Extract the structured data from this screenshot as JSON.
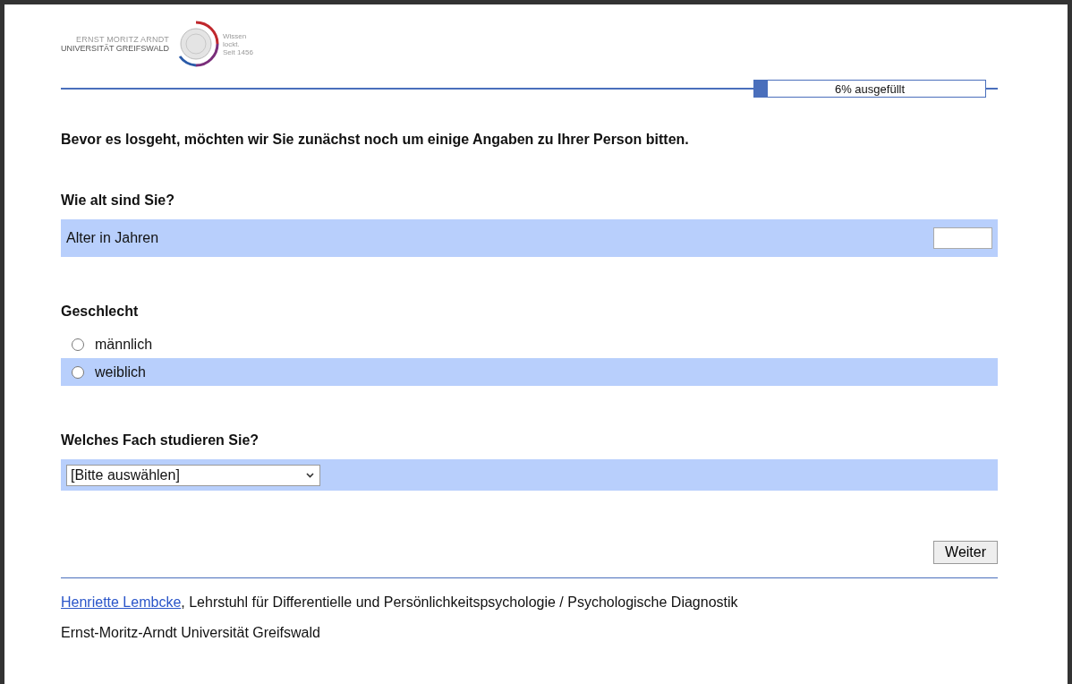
{
  "logo": {
    "line_1": "ERNST MORITZ ARNDT",
    "line_2": "UNIVERSITÄT GREIFSWALD",
    "motto": [
      "Wissen",
      "lockt.",
      "Seit 1456"
    ]
  },
  "progress": {
    "level": 0.06,
    "label": "6% ausgefüllt"
  },
  "intro": "Bevor es losgeht, möchten wir Sie zunächst noch um einige Angaben zu Ihrer Person bitten.",
  "questions": [
    {
      "kind": "text",
      "title": "Wie alt sind Sie?",
      "label": "Alter in Jahren"
    },
    {
      "kind": "radio",
      "title": "Geschlecht",
      "options": [
        {
          "label": "männlich",
          "selected": false
        },
        {
          "label": "weiblich",
          "selected": false
        }
      ]
    },
    {
      "kind": "select",
      "title": "Welches Fach studieren Sie?",
      "value": "[Bitte auswählen]"
    }
  ],
  "next_button": "Weiter",
  "footer": {
    "author_link": "Henriette Lembcke",
    "affiliation": ", Lehrstuhl für Differentielle und Persönlichkeitspsychologie / Psychologische Diagnostik",
    "university": "Ernst-Moritz-Arndt Universität Greifswald"
  }
}
